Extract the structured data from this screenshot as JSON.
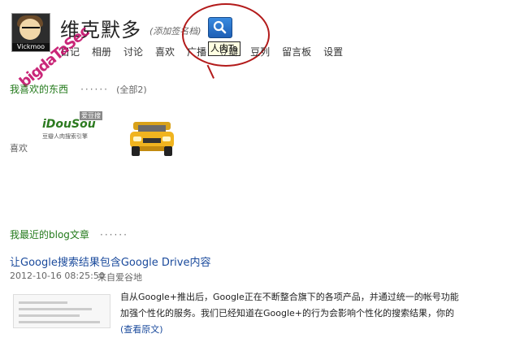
{
  "profile": {
    "avatar_tag": "Vickmoo",
    "name": "维克默多",
    "signature_hint": "(添加签名档)"
  },
  "nav": [
    "日记",
    "相册",
    "讨论",
    "喜欢",
    "广播",
    "豆瓣",
    "豆列",
    "留言板",
    "设置"
  ],
  "tooltip": "人肉Ta",
  "watermark": "bigdaTaSec",
  "likes": {
    "title": "我喜欢的东西",
    "dots": "······",
    "total": "(全部2)",
    "label": "喜欢",
    "idousou_logo": "iDouSou",
    "idousou_sub": "豆瓣人肉搜索引擎",
    "idousou_badge": "爱豆搜"
  },
  "blog": {
    "section_title": "我最近的blog文章",
    "dots": "······",
    "post_title": "让Google搜索结果包含Google Drive内容",
    "date": "2012-10-16 08:25:50",
    "source": "来自爱谷地",
    "body_lines": [
      "自从Google+推出后，Google正在不断整合旗下的各项产品，并通过统一的帐号功能",
      "加强个性化的服务。我们已经知道在Google+的行为会影响个性化的搜索结果，你的"
    ],
    "more": "(查看原文)"
  },
  "colors": {
    "section_green": "#237a1b",
    "link_blue": "#1a4a9c",
    "annotation_red": "#b31b1b",
    "watermark_pink": "#c40f6a"
  }
}
